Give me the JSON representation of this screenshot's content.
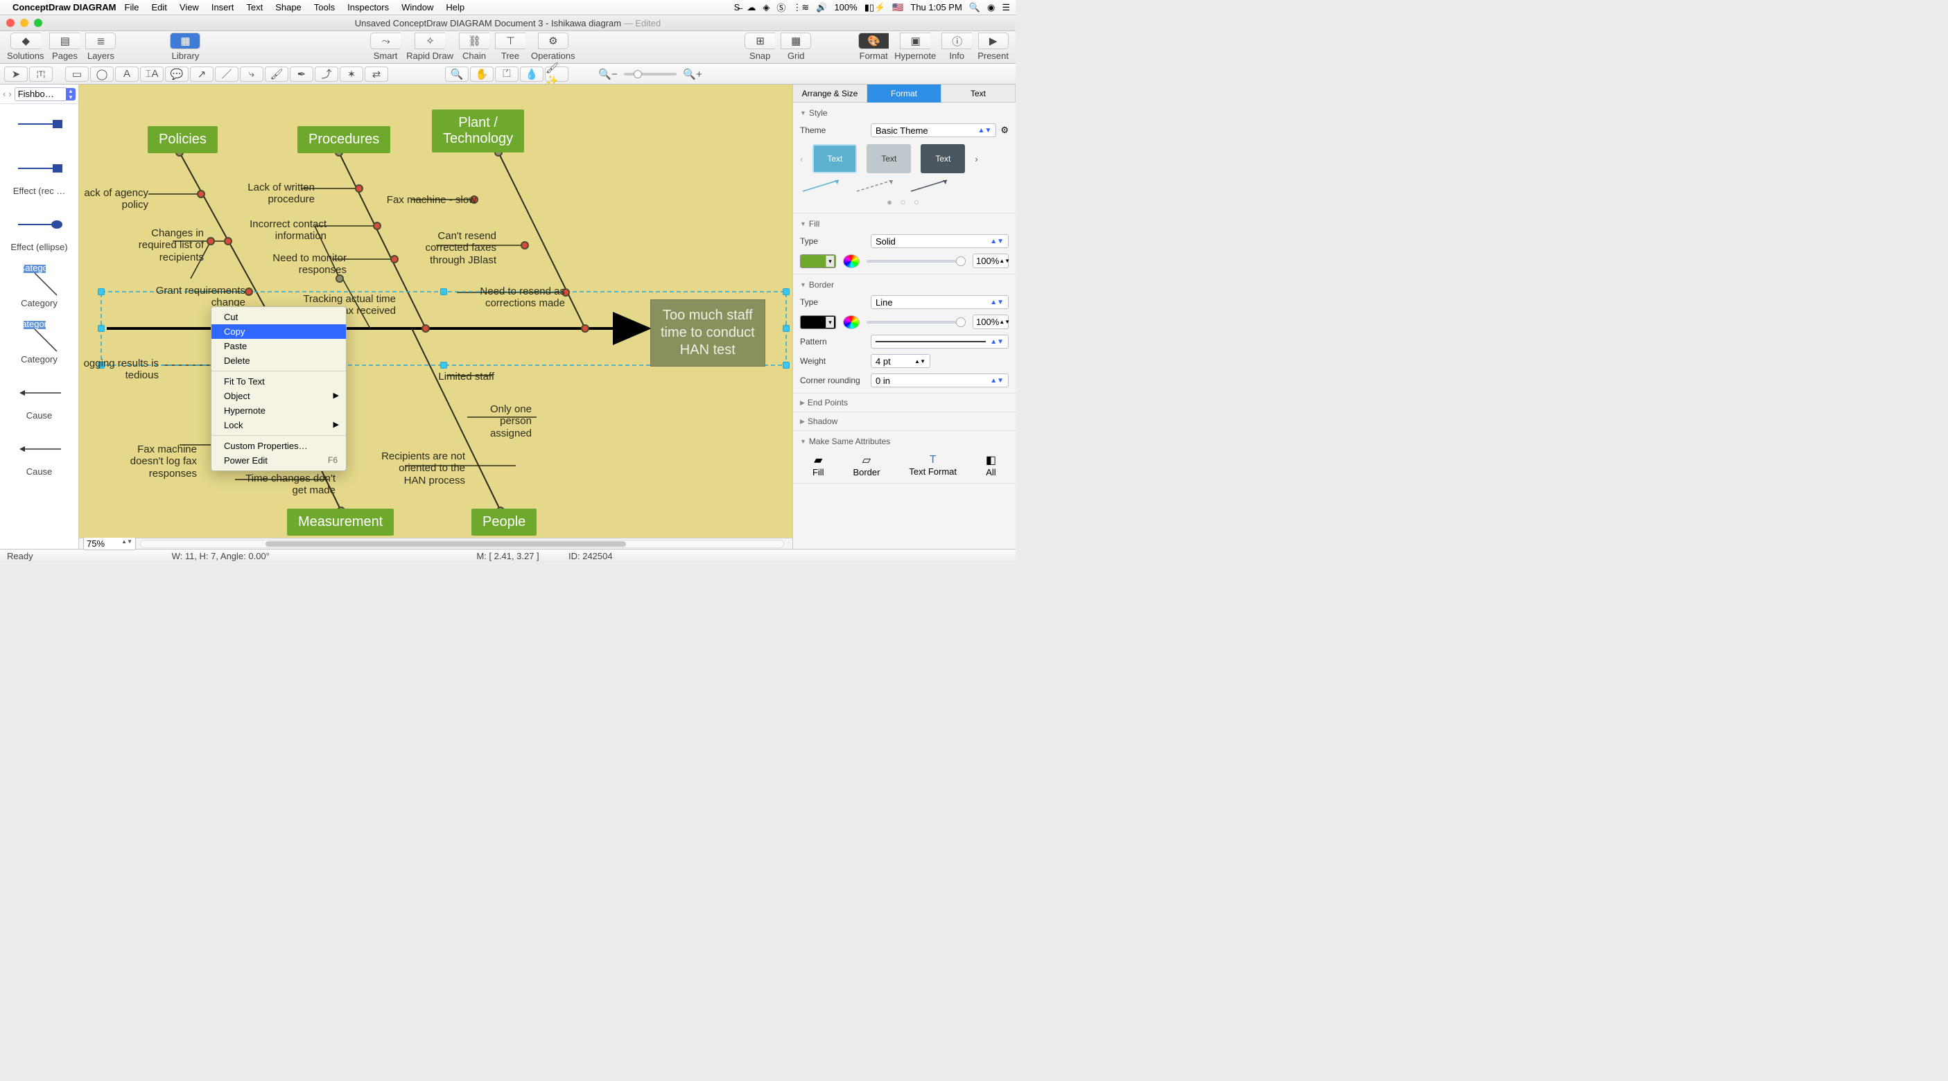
{
  "menubar": {
    "app": "ConceptDraw DIAGRAM",
    "items": [
      "File",
      "Edit",
      "View",
      "Insert",
      "Text",
      "Shape",
      "Tools",
      "Inspectors",
      "Window",
      "Help"
    ],
    "battery": "100%",
    "clock": "Thu 1:05 PM"
  },
  "window": {
    "title": "Unsaved ConceptDraw DIAGRAM Document 3 - Ishikawa diagram",
    "edited": "— Edited"
  },
  "toolbar": {
    "left": [
      "Solutions",
      "Pages",
      "Layers"
    ],
    "library": "Library",
    "mid": [
      "Smart",
      "Rapid Draw",
      "Chain",
      "Tree",
      "Operations"
    ],
    "snap": "Snap",
    "grid": "Grid",
    "right": [
      "Format",
      "Hypernote",
      "Info",
      "Present"
    ]
  },
  "stencil": {
    "nav_label": "Fishbo…",
    "items": [
      "",
      "Effect (rec …",
      "Effect (ellipse)",
      "Category",
      "Category",
      "Cause",
      "Cause"
    ]
  },
  "zoom_combo": "75%",
  "status": {
    "ready": "Ready",
    "whangle": "W: 11,  H: 7,  Angle: 0.00°",
    "mouse": "M: [ 2.41, 3.27 ]",
    "id": "ID: 242504"
  },
  "rpanel": {
    "tabs": [
      "Arrange & Size",
      "Format",
      "Text"
    ],
    "active_tab": 1,
    "style": {
      "head": "Style",
      "theme_label": "Theme",
      "theme_value": "Basic Theme",
      "swatch_text": "Text"
    },
    "fill": {
      "head": "Fill",
      "type_label": "Type",
      "type_value": "Solid",
      "color": "#6ea92e",
      "opacity": "100%"
    },
    "border": {
      "head": "Border",
      "type_label": "Type",
      "type_value": "Line",
      "color": "#000000",
      "opacity": "100%",
      "pattern_label": "Pattern",
      "weight_label": "Weight",
      "weight_value": "4 pt",
      "corner_label": "Corner rounding",
      "corner_value": "0 in"
    },
    "endpoints": "End Points",
    "shadow": "Shadow",
    "same": {
      "head": "Make Same Attributes",
      "items": [
        "Fill",
        "Border",
        "Text Format",
        "All"
      ]
    }
  },
  "contextmenu": {
    "items": [
      "Cut",
      "Copy",
      "Paste",
      "Delete",
      "-",
      "Fit To Text",
      "Object",
      "Hypernote",
      "Lock",
      "-",
      "Custom Properties…",
      "Power Edit"
    ],
    "submenu": [
      "Object",
      "Lock"
    ],
    "shortcut_for": {
      "Power Edit": "F6"
    },
    "highlight": "Copy"
  },
  "diagram": {
    "categories_top": [
      "Policies",
      "Procedures",
      "Plant /\nTechnology"
    ],
    "categories_bottom": [
      "Measurement",
      "People"
    ],
    "effect": "Too much staff\ntime to conduct\nHAN test",
    "causes": {
      "policies": [
        "ack of agency\npolicy",
        "Changes in\nrequired list of\nrecipients",
        "Grant requirements\nchange"
      ],
      "procedures": [
        "Lack of written\nprocedure",
        "Incorrect contact\ninformation",
        "Need to monitor\nresponses",
        "Tracking actual time\nfax received"
      ],
      "plant": [
        "Fax machine - slow",
        "Can't resend\ncorrected faxes\nthrough JBlast",
        "Need to resend as\ncorrections made"
      ],
      "measurement_left": [
        "ogging results is\ntedious",
        "Fax machine\ndoesn't log fax\nresponses"
      ],
      "measurement_right": [
        "Time changes don't\nget made"
      ],
      "people": [
        "Limited staff",
        "Only one\nperson\nassigned",
        "Recipients are not\noriented to the\nHAN process"
      ]
    }
  }
}
